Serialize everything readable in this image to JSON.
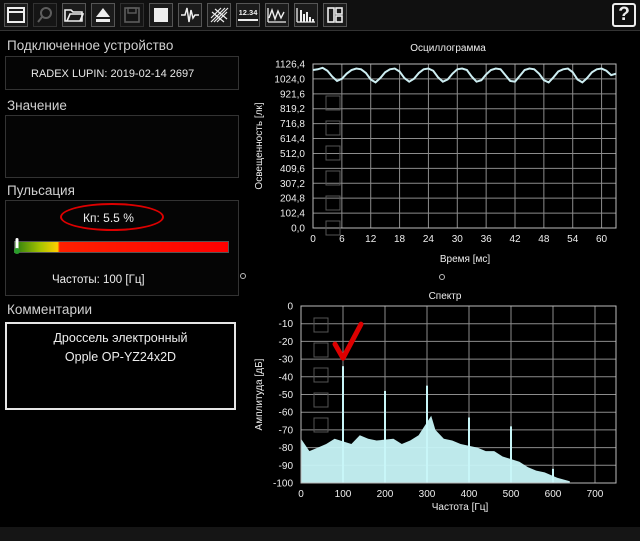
{
  "toolbar": {
    "buttons": [
      "window-icon",
      "search-icon",
      "folder-icon",
      "eject-icon",
      "save-icon",
      "stop-icon",
      "waveform-icon",
      "grid-icon",
      "numeric-display-icon",
      "oscilloscope-icon",
      "spectrum-icon",
      "layout-icon"
    ],
    "numeric_label": "12.34",
    "help_label": "?"
  },
  "sidebar": {
    "connected_device_label": "Подключенное устройство",
    "device_name": "RADEX LUPIN: 2019-02-14 2697",
    "value_label": "Значение",
    "pulsation_label": "Пульсация",
    "kp_label": "Кп:",
    "kp_value": "5.5 %",
    "kp_fraction": 0.055,
    "frequency_text": "Частоты: 100 [Гц]",
    "comments_label": "Комментарии",
    "comment_line1": "Дроссель электронный",
    "comment_line2": "Opple OP-YZ24x2D"
  },
  "colors": {
    "trace": "#cdeef2",
    "bars": "#c8f6f8",
    "annotation": "#dd0000",
    "grid": "#8c8c8c"
  },
  "chart_data": [
    {
      "type": "line",
      "title": "Осциллограмма",
      "xlabel": "Время [мс]",
      "ylabel": "Освещенность [лк]",
      "xlim": [
        0,
        63
      ],
      "ylim": [
        0,
        1126.4
      ],
      "x_ticks": [
        "0",
        "6",
        "12",
        "18",
        "24",
        "30",
        "36",
        "42",
        "48",
        "54",
        "60"
      ],
      "y_ticks": [
        "0,0",
        "102,4",
        "204,8",
        "307,2",
        "409,6",
        "512,0",
        "614,4",
        "716,8",
        "819,2",
        "921,6",
        "1024,0",
        "1126,4"
      ],
      "grid": true,
      "series": [
        {
          "x": [
            0,
            1,
            2,
            3,
            4,
            5,
            6,
            7,
            8,
            9,
            10,
            11,
            12,
            13,
            14,
            15,
            16,
            17,
            18,
            19,
            20,
            21,
            22,
            23,
            24,
            25,
            26,
            27,
            28,
            29,
            30,
            31,
            32,
            33,
            34,
            35,
            36,
            37,
            38,
            39,
            40,
            41,
            42,
            43,
            44,
            45,
            46,
            47,
            48,
            49,
            50,
            51,
            52,
            53,
            54,
            55,
            56,
            57,
            58,
            59,
            60,
            61,
            62,
            63
          ],
          "values": [
            1085,
            1090,
            1100,
            1080,
            1040,
            1010,
            1025,
            1060,
            1085,
            1095,
            1090,
            1065,
            1020,
            1000,
            1030,
            1070,
            1090,
            1095,
            1075,
            1030,
            1005,
            1025,
            1065,
            1090,
            1095,
            1080,
            1035,
            1005,
            1020,
            1060,
            1090,
            1095,
            1085,
            1040,
            1005,
            1015,
            1055,
            1085,
            1095,
            1090,
            1050,
            1010,
            1005,
            1045,
            1085,
            1095,
            1090,
            1060,
            1015,
            1000,
            1035,
            1075,
            1090,
            1095,
            1070,
            1020,
            1000,
            1030,
            1070,
            1090,
            1095,
            1080,
            1050,
            1060
          ]
        }
      ]
    },
    {
      "type": "bar",
      "title": "Спектр",
      "xlabel": "Частота [Гц]",
      "ylabel": "Амплитуда [дБ]",
      "xlim": [
        0,
        750
      ],
      "ylim": [
        -100,
        0
      ],
      "x_ticks": [
        "0",
        "100",
        "200",
        "300",
        "400",
        "500",
        "600",
        "700"
      ],
      "y_ticks": [
        "0",
        "-10",
        "-20",
        "-30",
        "-40",
        "-50",
        "-60",
        "-70",
        "-80",
        "-90",
        "-100"
      ],
      "grid": true,
      "peaks": [
        {
          "x": 100,
          "y": -34
        },
        {
          "x": 200,
          "y": -48
        },
        {
          "x": 300,
          "y": -45
        },
        {
          "x": 400,
          "y": -63
        },
        {
          "x": 500,
          "y": -68
        },
        {
          "x": 600,
          "y": -92
        }
      ],
      "noise": [
        {
          "x": 0,
          "y": -75
        },
        {
          "x": 20,
          "y": -82
        },
        {
          "x": 40,
          "y": -80
        },
        {
          "x": 60,
          "y": -78
        },
        {
          "x": 80,
          "y": -75
        },
        {
          "x": 120,
          "y": -78
        },
        {
          "x": 140,
          "y": -73
        },
        {
          "x": 160,
          "y": -75
        },
        {
          "x": 180,
          "y": -76
        },
        {
          "x": 220,
          "y": -75
        },
        {
          "x": 240,
          "y": -78
        },
        {
          "x": 260,
          "y": -76
        },
        {
          "x": 280,
          "y": -73
        },
        {
          "x": 310,
          "y": -62
        },
        {
          "x": 320,
          "y": -70
        },
        {
          "x": 340,
          "y": -75
        },
        {
          "x": 360,
          "y": -76
        },
        {
          "x": 380,
          "y": -78
        },
        {
          "x": 420,
          "y": -80
        },
        {
          "x": 440,
          "y": -82
        },
        {
          "x": 460,
          "y": -82
        },
        {
          "x": 480,
          "y": -85
        },
        {
          "x": 520,
          "y": -88
        },
        {
          "x": 540,
          "y": -91
        },
        {
          "x": 560,
          "y": -93
        },
        {
          "x": 580,
          "y": -94
        },
        {
          "x": 610,
          "y": -97
        },
        {
          "x": 640,
          "y": -99
        }
      ],
      "marker": {
        "x": 100,
        "y": -34
      }
    }
  ]
}
